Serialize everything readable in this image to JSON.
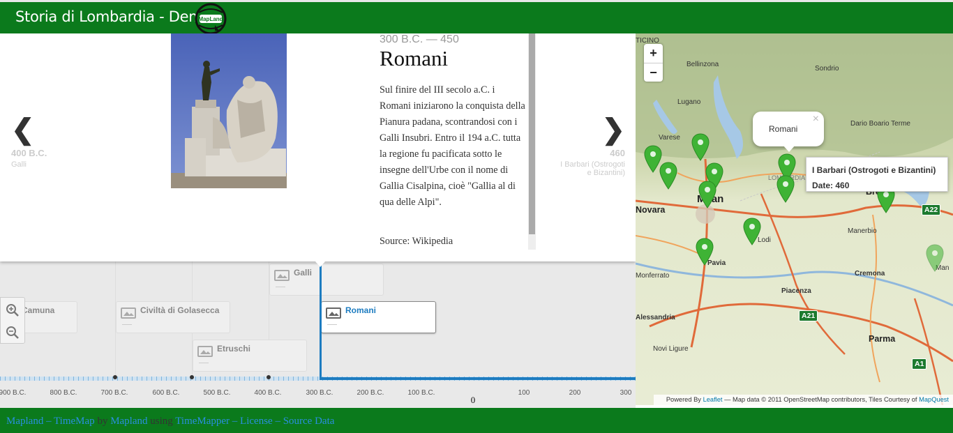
{
  "header": {
    "title": "Storia di Lombardia - Demo",
    "logo_text": "MapLand"
  },
  "slide": {
    "dates": "300 B.C. — 450",
    "title": "Romani",
    "body": "Sul finire del III secolo a.C. i Romani iniziarono la conquista della Pianura padana, scontrandosi con i Galli Insubri. Entro il 194 a.C. tutta la regione fu pacificata sotto le insegne dell'Urbe con il nome di Gallia Cisalpina, cioè \"Gallia al di qua delle Alpi\".",
    "source": "Source: Wikipedia",
    "prev": {
      "arrow": "❮",
      "date": "400 B.C.",
      "label": "Galli"
    },
    "next": {
      "arrow": "❯",
      "date": "460",
      "label": "I Barbari (Ostrogoti e Bizantini)"
    }
  },
  "timeline": {
    "events": [
      {
        "label": "Camuna"
      },
      {
        "label": "Civiltà di Golasecca"
      },
      {
        "label": "Galli"
      },
      {
        "label": "Etruschi"
      },
      {
        "label": "Romani"
      }
    ],
    "ticks": [
      "900 B.C.",
      "800 B.C.",
      "700 B.C.",
      "600 B.C.",
      "500 B.C.",
      "400 B.C.",
      "300 B.C.",
      "200 B.C.",
      "100 B.C.",
      "100",
      "200",
      "300"
    ],
    "zero_label": "0"
  },
  "map": {
    "popup_text": "Romani",
    "popup_close": "×",
    "tooltip_title": "I Barbari (Ostrogoti e Bizantini)",
    "tooltip_date": "Date: 460",
    "zoom_in": "+",
    "zoom_out": "−",
    "labels": {
      "ticino": "TICINO",
      "bellinzona": "Bellinzona",
      "sondrio": "Sondrio",
      "lugano": "Lugano",
      "varese": "Varese",
      "dario": "Dario Boario Terme",
      "lombardia": "LOMBARDIA",
      "milan": "Milan",
      "novara": "Novara",
      "brescia": "Bres",
      "manerbio": "Manerbio",
      "lodi": "Lodi",
      "pavia": "Pavia",
      "cremona": "Cremona",
      "monferrato": "Monferrato",
      "piacenza": "Piacenza",
      "alessandria": "Alessandria",
      "novi": "Novi Ligure",
      "parma": "Parma",
      "mantova": "Man"
    },
    "roads": [
      "A22",
      "A21",
      "A1"
    ],
    "attribution_prefix": "Powered By",
    "attribution_leaflet": "Leaflet",
    "attribution_middle": "— Map data © 2011 OpenStreetMap contributors, Tiles Courtesy of",
    "attribution_mapquest": "MapQuest"
  },
  "footer": {
    "link1": "Mapland – TimeMap",
    "by": "by",
    "link2": "Mapland",
    "using": "using",
    "link3": "TimeMapper",
    "sep1": "–",
    "link4": "License",
    "sep2": "–",
    "link5": "Source Data"
  },
  "colors": {
    "header_green": "#0b7a1c",
    "timeline_blue": "#1d7cc0",
    "pin_green": "#3fb335"
  }
}
